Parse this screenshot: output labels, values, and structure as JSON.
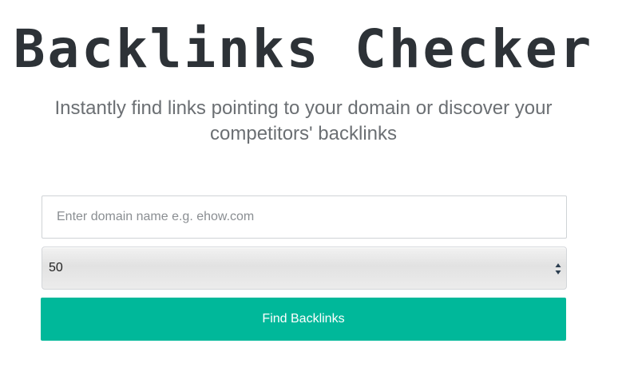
{
  "header": {
    "title": "Backlinks Checker",
    "subtitle": "Instantly find links pointing to your domain or discover your competitors' backlinks"
  },
  "form": {
    "domain_placeholder": "Enter domain name e.g. ehow.com",
    "domain_value": "",
    "count_selected": "50",
    "submit_label": "Find Backlinks"
  },
  "colors": {
    "accent": "#00b89a",
    "title": "#2d3237",
    "subtitle": "#6b6f73"
  },
  "icons": {
    "select_arrows": "up-down-chevron-icon"
  }
}
